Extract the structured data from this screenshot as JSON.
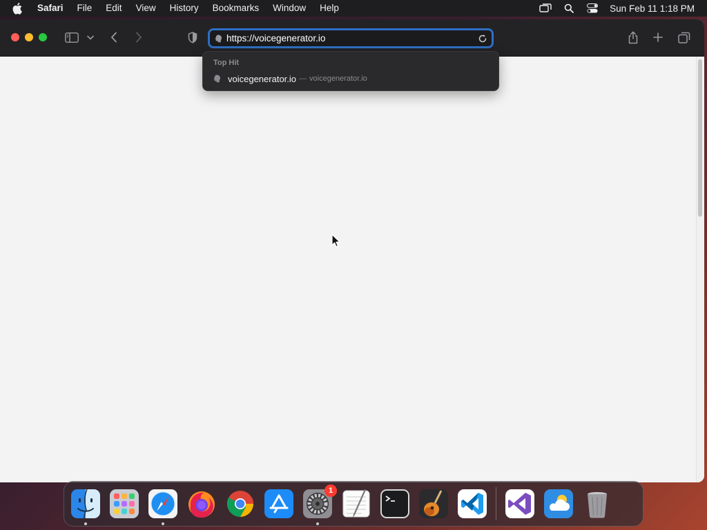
{
  "menubar": {
    "app_name": "Safari",
    "items": [
      "File",
      "Edit",
      "View",
      "History",
      "Bookmarks",
      "Window",
      "Help"
    ],
    "clock": "Sun Feb 11  1:18 PM"
  },
  "address_bar": {
    "value": "https://voicegenerator.io"
  },
  "suggestions": {
    "heading": "Top Hit",
    "items": [
      {
        "title": "voicegenerator.io",
        "separator": "—",
        "url": "voicegenerator.io"
      }
    ]
  },
  "dock": {
    "apps": [
      {
        "name": "Finder",
        "icon": "finder-icon",
        "running": true
      },
      {
        "name": "Launchpad",
        "icon": "launchpad-icon",
        "running": false
      },
      {
        "name": "Safari",
        "icon": "safari-icon",
        "running": true
      },
      {
        "name": "Firefox",
        "icon": "firefox-icon",
        "running": false
      },
      {
        "name": "Google Chrome",
        "icon": "chrome-icon",
        "running": false
      },
      {
        "name": "App Store",
        "icon": "app-store-icon",
        "running": false
      },
      {
        "name": "System Settings",
        "icon": "system-settings-icon",
        "running": true,
        "badge": "1"
      },
      {
        "name": "TextEdit",
        "icon": "textedit-icon",
        "running": false
      },
      {
        "name": "Terminal",
        "icon": "terminal-icon",
        "running": false
      },
      {
        "name": "GarageBand",
        "icon": "garageband-icon",
        "running": false
      },
      {
        "name": "Visual Studio Code",
        "icon": "vscode-icon",
        "running": false
      },
      {
        "name": "Visual Studio",
        "icon": "visual-studio-icon",
        "running": false
      },
      {
        "name": "Cloud Drive",
        "icon": "cloud-icon",
        "running": false
      },
      {
        "name": "Trash",
        "icon": "trash-icon",
        "running": false
      }
    ]
  },
  "colors": {
    "focus_ring": "#2f6fc4",
    "traffic_close": "#ff5f57",
    "traffic_minimize": "#febc2e",
    "traffic_zoom": "#28c840",
    "badge": "#ff3b30"
  }
}
